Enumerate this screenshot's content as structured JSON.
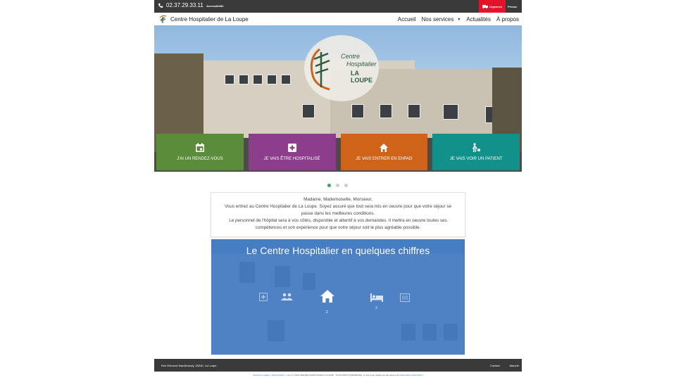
{
  "topbar": {
    "phone": "02.37.29.33.11",
    "accessibility": "Accessibilité",
    "emergency": "Urgences",
    "press": "Presse"
  },
  "nav": {
    "brand": "Centre Hospitalier de La Loupe",
    "items": [
      "Accueil",
      "Nos services",
      "Actualités",
      "À propos"
    ]
  },
  "hero": {
    "logo_line1": "Centre",
    "logo_line2": "Hospitalier",
    "logo_line3": "LA LOUPE",
    "tiles": [
      {
        "label": "J'AI UN RENDEZ-VOUS",
        "icon": "calendar-icon",
        "color": "#5b8c3a"
      },
      {
        "label": "JE VAIS ÊTRE HOSPITALISÉ",
        "icon": "medical-plus-icon",
        "color": "#8c3d8c"
      },
      {
        "label": "JE VAIS ENTRER EN EHPAD",
        "icon": "home-icon",
        "color": "#d0631a"
      },
      {
        "label": "JE VAIS VOIR UN PATIENT",
        "icon": "visitor-icon",
        "color": "#11918a"
      }
    ]
  },
  "welcome": {
    "line1": "Madame, Mademoiselle, Monsieur,",
    "line2": "Vous entrez au Centre Hospitalier de La Loupe. Soyez assuré que tout sera mis en oeuvre pour que votre séjour se",
    "line3": "passe dans les meilleures conditions.",
    "line4": "Le personnel de l'hôpital sera à vos côtés, disponible et attentif à vos demandes. Il mettra en oeuvre toutes ses",
    "line5": "compétences et son expérience pour que votre séjour soit le plus agréable possible."
  },
  "figures": {
    "title": "Le Centre Hospitalier en quelques chiffres",
    "active_value": "2",
    "bed_value": "3"
  },
  "footer": {
    "address": "Rue Edmond Marcilhacwy, 28240, La Loupe",
    "contact": "Contact",
    "markets": "Marché",
    "legal_links": "Mentions Légales - Administration - Liens",
    "legal_text": "© 2016 CENTRE HOSPITALIER LA LOUPE - TOUS DROITS RÉSERVÉS. Le site a été réalisé par des élèves de l'école",
    "legal_school": "Web Code School"
  },
  "colors": {
    "accent_green": "#3aa657",
    "urgent_red": "#e3132a",
    "figures_blue": "#4a7fc0"
  }
}
